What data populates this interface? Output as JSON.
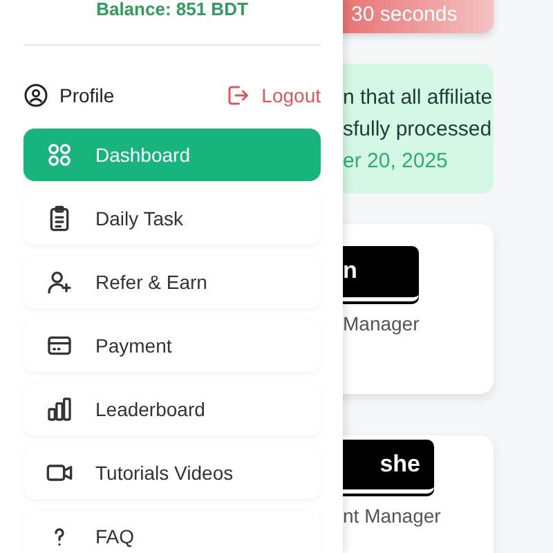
{
  "drawer": {
    "balance": "Balance: 851 BDT",
    "profile": "Profile",
    "logout": "Logout",
    "items": [
      {
        "label": "Dashboard",
        "kind": "grid",
        "selected": true
      },
      {
        "label": "Daily Task",
        "kind": "clipboard",
        "selected": false
      },
      {
        "label": "Refer & Earn",
        "kind": "adduser",
        "selected": false
      },
      {
        "label": "Payment",
        "kind": "card",
        "selected": false
      },
      {
        "label": "Leaderboard",
        "kind": "bars",
        "selected": false
      },
      {
        "label": "Tutorials Videos",
        "kind": "video",
        "selected": false
      },
      {
        "label": "FAQ",
        "kind": "help",
        "selected": false
      }
    ]
  },
  "background": {
    "timer": "30 seconds",
    "notice_lines": [
      "n that all affiliate",
      "sfully processed"
    ],
    "notice_date": "er 20, 2025",
    "managers": [
      {
        "name": "n",
        "role": "Manager"
      },
      {
        "name": "she",
        "role": "nt Manager"
      }
    ]
  }
}
